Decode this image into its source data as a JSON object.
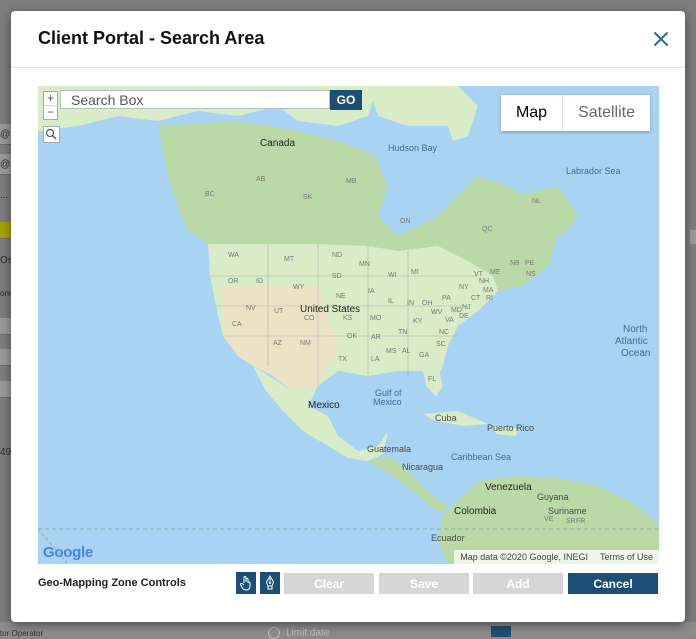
{
  "background": {
    "snippets": [
      "@m",
      "@m",
      "...",
      "Os",
      "onn",
      "49",
      "tor Operator"
    ],
    "limit_label": "Limit date"
  },
  "modal": {
    "title": "Client Portal - Search Area",
    "close_icon": "close-icon"
  },
  "map": {
    "search_placeholder": "Search Box",
    "search_value": "",
    "go_label": "GO",
    "zoom_in": "+",
    "zoom_out": "−",
    "map_type_active": "Map",
    "map_type_inactive": "Satellite",
    "labels": {
      "hudson_bay": "Hudson Bay",
      "labrador_sea": "Labrador Sea",
      "canada": "Canada",
      "north_atlantic_1": "North",
      "north_atlantic_2": "Atlantic",
      "north_atlantic_3": "Ocean",
      "united_states": "United States",
      "mexico": "Mexico",
      "gulf_1": "Gulf of",
      "gulf_2": "Mexico",
      "cuba": "Cuba",
      "puerto_rico": "Puerto Rico",
      "guatemala": "Guatemala",
      "nicaragua": "Nicaragua",
      "caribbean": "Caribbean Sea",
      "venezuela": "Venezuela",
      "guyana": "Guyana",
      "suriname": "Suriname",
      "colombia": "Colombia",
      "ecuador": "Ecuador",
      "ab": "AB",
      "mb": "MB",
      "sk": "SK",
      "bc": "BC",
      "on": "ON",
      "qc": "QC",
      "nl": "NL",
      "nb": "NB",
      "ns": "NS",
      "pe": "PE",
      "wa": "WA",
      "mt": "MT",
      "nd": "ND",
      "mn": "MN",
      "me": "ME",
      "or": "OR",
      "id": "ID",
      "wy": "WY",
      "sd": "SD",
      "wi": "WI",
      "mi": "MI",
      "ny": "NY",
      "vt": "VT",
      "nh": "NH",
      "ma": "MA",
      "ri": "RI",
      "ct": "CT",
      "ne": "NE",
      "ia": "IA",
      "il": "IL",
      "in": "IN",
      "oh": "OH",
      "pa": "PA",
      "nj": "NJ",
      "nv": "NV",
      "ut": "UT",
      "co": "CO",
      "ks": "KS",
      "mo": "MO",
      "ky": "KY",
      "wv": "WV",
      "va": "VA",
      "md": "MD",
      "de": "DE",
      "ca": "CA",
      "az": "AZ",
      "nm": "NM",
      "ok": "OK",
      "ar": "AR",
      "tn": "TN",
      "nc": "NC",
      "sc": "SC",
      "ms": "MS",
      "al": "AL",
      "ga": "GA",
      "la": "LA",
      "tx": "TX",
      "fl": "FL",
      "ve": "VE",
      "fr": "FR",
      "sr": "SR"
    },
    "logo_text": "Google",
    "attribution": "Map data ©2020 Google, INEGI",
    "terms": "Terms of Use"
  },
  "footer": {
    "label": "Geo-Mapping Zone Controls",
    "tools": [
      "hand-icon",
      "pen-icon"
    ],
    "clear": "Clear",
    "save": "Save",
    "add": "Add",
    "cancel": "Cancel"
  },
  "colors": {
    "primary": "#1b4f76",
    "disabled": "#d6d6d6",
    "water": "#a9d3f2",
    "land": "#d8ecc8",
    "forest": "#b9daa6",
    "desert": "#ece3c6"
  }
}
